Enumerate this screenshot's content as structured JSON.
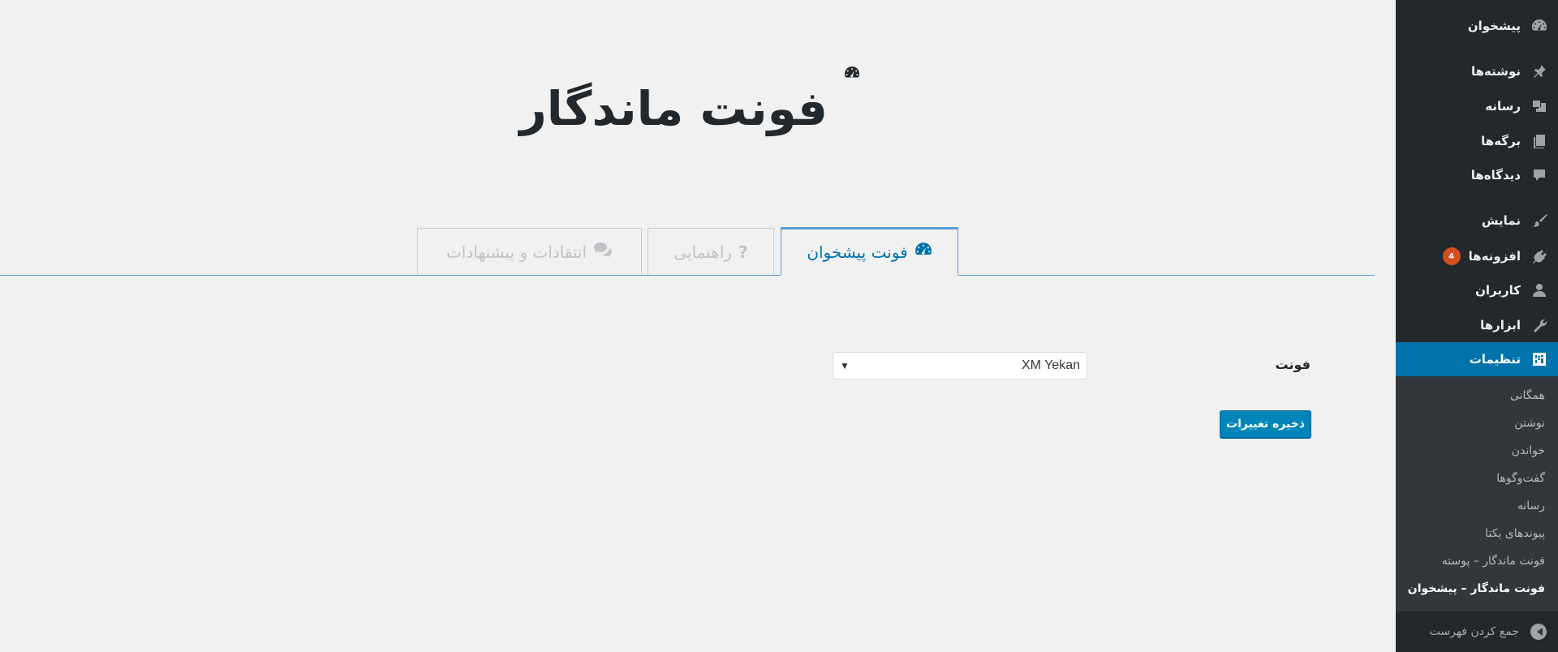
{
  "page": {
    "title": "فونت ماندگار"
  },
  "tabs": [
    {
      "label": "فونت پیشخوان",
      "icon": "dashboard-icon",
      "active": true
    },
    {
      "label": "راهنمایی",
      "icon": "question-icon",
      "active": false
    },
    {
      "label": "انتقادات و پیشنهادات",
      "icon": "comments-icon",
      "active": false
    }
  ],
  "form": {
    "font_label": "فونت",
    "font_value": "XM Yekan",
    "save_label": "ذخیره تغییرات"
  },
  "sidebar": {
    "items": [
      {
        "label": "پیشخوان",
        "icon": "dashboard-icon"
      },
      {
        "label": "نوشته‌ها",
        "icon": "pin-icon"
      },
      {
        "label": "رسانه",
        "icon": "media-icon"
      },
      {
        "label": "برگه‌ها",
        "icon": "pages-icon"
      },
      {
        "label": "دیدگاه‌ها",
        "icon": "comment-icon"
      },
      {
        "label": "نمایش",
        "icon": "brush-icon"
      },
      {
        "label": "افزونه‌ها",
        "icon": "plugin-icon",
        "badge": "4"
      },
      {
        "label": "کاربران",
        "icon": "user-icon"
      },
      {
        "label": "ابزارها",
        "icon": "wrench-icon"
      },
      {
        "label": "تنظیمات",
        "icon": "settings-icon",
        "current": true
      }
    ],
    "submenu": [
      {
        "label": "همگانی"
      },
      {
        "label": "نوشتن"
      },
      {
        "label": "خواندن"
      },
      {
        "label": "گفت‌وگوها"
      },
      {
        "label": "رسانه"
      },
      {
        "label": "پیوندهای یکتا"
      },
      {
        "label": "فونت ماندگار – پوسته"
      },
      {
        "label": "فونت ماندگار – پیشخوان",
        "current": true
      }
    ],
    "collapse_label": "جمع کردن فهرست"
  },
  "colors": {
    "sidebar_bg": "#23282d",
    "submenu_bg": "#32373c",
    "accent": "#0073aa",
    "button": "#0085ba",
    "badge": "#d54e21",
    "page_bg": "#f1f1f1"
  }
}
